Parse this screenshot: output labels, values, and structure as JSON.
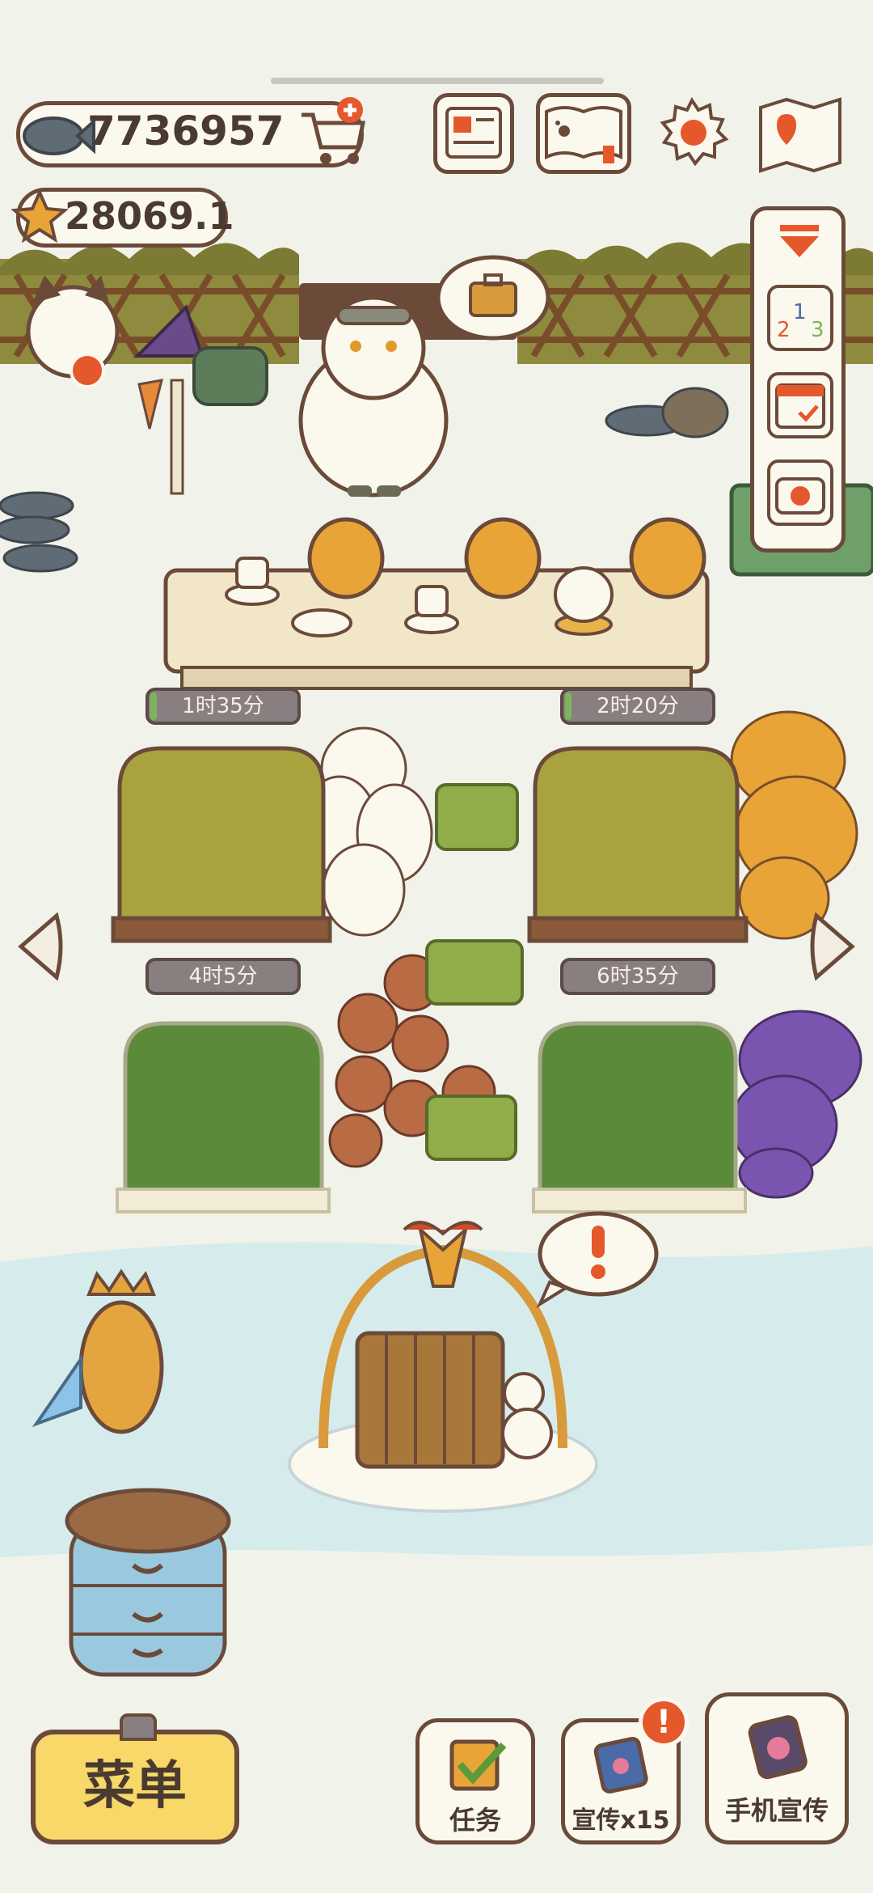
{
  "currency": {
    "fish": "7736957",
    "stars": "28069.1"
  },
  "timers": [
    {
      "label": "1时35分",
      "progress": 0.05
    },
    {
      "label": "2时20分",
      "progress": 0.05
    },
    {
      "label": "4时5分",
      "progress": 0.0
    },
    {
      "label": "6时35分",
      "progress": 0.0
    }
  ],
  "bottom_bar": {
    "menu_label": "菜单",
    "tasks_label": "任务",
    "promote_label": "宣传x15",
    "phone_promote_label": "手机宣传"
  },
  "top_icons": [
    "newspaper-icon",
    "pawbook-icon",
    "settings-gear-icon",
    "map-icon"
  ],
  "side_panel": [
    "collapse-arrow-icon",
    "ranking-podium-icon",
    "calendar-icon",
    "camera-icon"
  ],
  "colors": {
    "outline": "#6b4a3a",
    "accent_orange": "#e5582b",
    "menu_yellow": "#f8d868",
    "snow_blue": "#d6ecec"
  }
}
